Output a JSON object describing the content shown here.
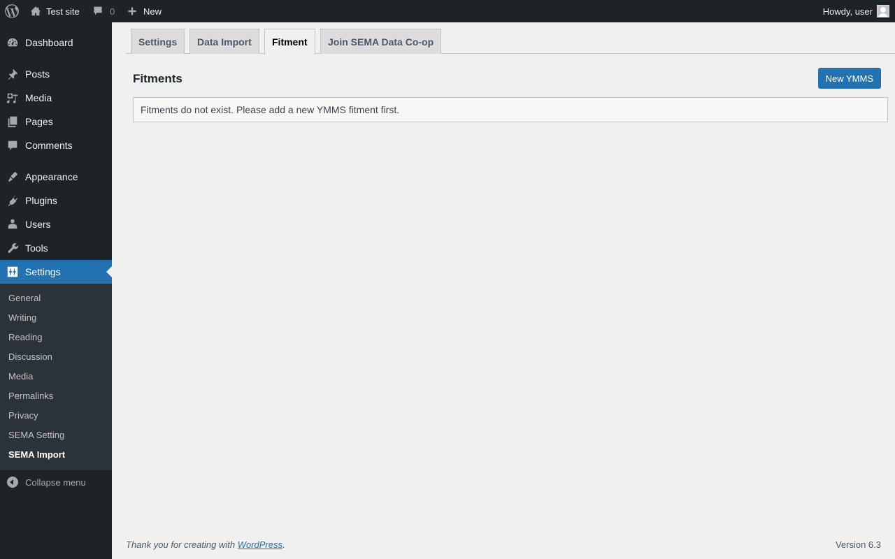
{
  "adminbar": {
    "site_name": "Test site",
    "comments_count": "0",
    "new_label": "New",
    "howdy": "Howdy, user"
  },
  "sidebar": {
    "items": [
      {
        "label": "Dashboard",
        "icon": "dashboard-icon"
      },
      {
        "label": "Posts",
        "icon": "pin-icon"
      },
      {
        "label": "Media",
        "icon": "media-icon"
      },
      {
        "label": "Pages",
        "icon": "pages-icon"
      },
      {
        "label": "Comments",
        "icon": "comment-icon"
      },
      {
        "label": "Appearance",
        "icon": "brush-icon"
      },
      {
        "label": "Plugins",
        "icon": "plugin-icon"
      },
      {
        "label": "Users",
        "icon": "users-icon"
      },
      {
        "label": "Tools",
        "icon": "wrench-icon"
      },
      {
        "label": "Settings",
        "icon": "settings-icon"
      }
    ],
    "submenu": [
      "General",
      "Writing",
      "Reading",
      "Discussion",
      "Media",
      "Permalinks",
      "Privacy",
      "SEMA Setting",
      "SEMA Import"
    ],
    "collapse_label": "Collapse menu"
  },
  "tabs": [
    "Settings",
    "Data Import",
    "Fitment",
    "Join SEMA Data Co-op"
  ],
  "main": {
    "title": "Fitments",
    "new_button": "New YMMS",
    "notice": "Fitments do not exist. Please add a new YMMS fitment first."
  },
  "footer": {
    "thanks_prefix": "Thank you for creating with ",
    "wp_link": "WordPress",
    "thanks_suffix": ".",
    "version": "Version 6.3"
  },
  "colors": {
    "accent": "#2271b1",
    "sidebar_bg": "#1d2327",
    "submenu_bg": "#2c3338"
  }
}
